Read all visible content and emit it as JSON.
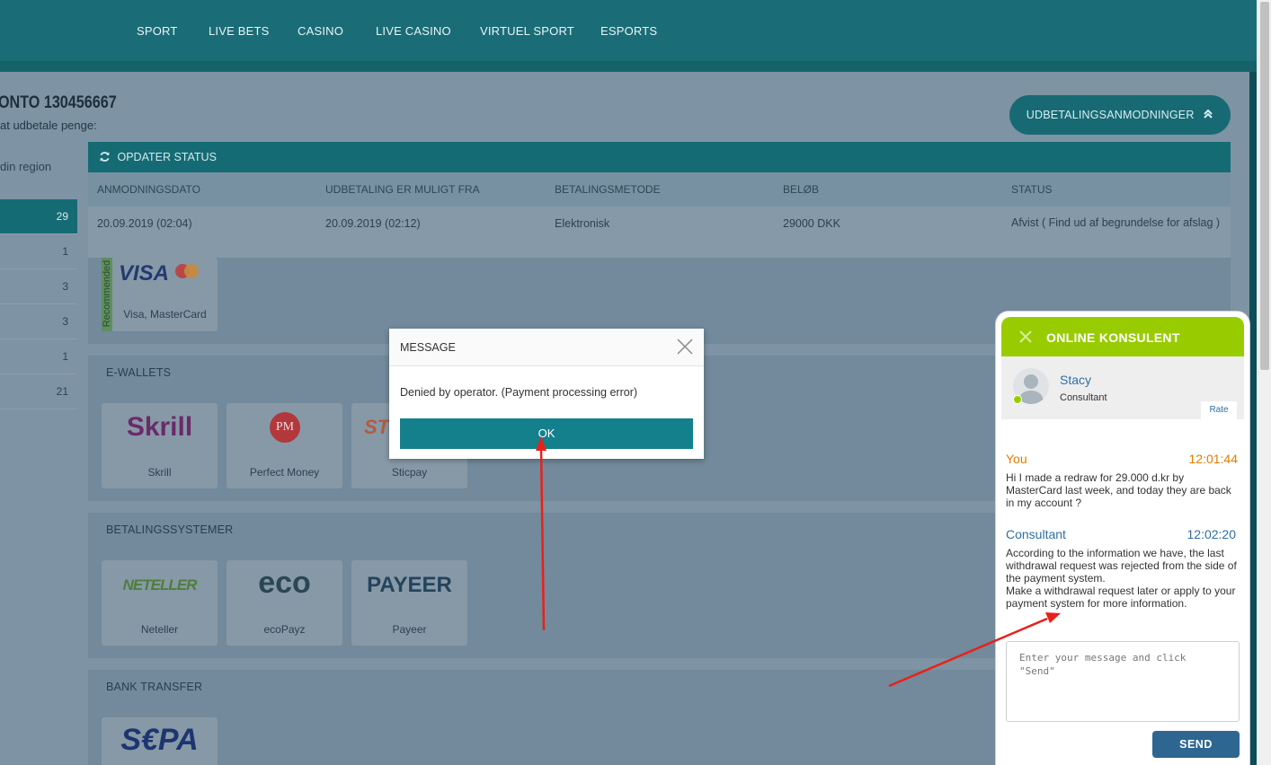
{
  "nav": {
    "items": [
      "SPORT",
      "LIVE BETS",
      "CASINO",
      "LIVE CASINO",
      "VIRTUEL SPORT",
      "ESPORTS"
    ]
  },
  "account": {
    "title": "ONTO 130456667",
    "subtitle": "at udbetale penge:",
    "region": "din region"
  },
  "left_counts": [
    "29",
    "1",
    "3",
    "3",
    "1",
    "21"
  ],
  "withdraw_button": "UDBETALINGSANMODNINGER",
  "status": {
    "refresh_label": "OPDATER STATUS",
    "columns": [
      "ANMODNINGSDATO",
      "UDBETALING ER MULIGT FRA",
      "BETALINGSMETODE",
      "BELØB",
      "STATUS"
    ],
    "row": [
      "20.09.2019 (02:04)",
      "20.09.2019 (02:12)",
      "Elektronisk",
      "29000 DKK",
      "Afvist ( Find ud af begrundelse for afslag )"
    ]
  },
  "cards_section": {
    "recommended_badge": "Recommended",
    "visa_logo": "VISA",
    "visa_label": "Visa, MasterCard"
  },
  "ewallets": {
    "title": "E-WALLETS",
    "cards": [
      {
        "logo": "Skrill",
        "label": "Skrill"
      },
      {
        "logo": "PM",
        "label": "Perfect Money"
      },
      {
        "logo": "ST",
        "label": "Sticpay"
      }
    ]
  },
  "payment_systems": {
    "title": "BETALINGSSYSTEMER",
    "cards": [
      {
        "logo": "NETELLER",
        "label": "Neteller"
      },
      {
        "logo": "eco",
        "label": "ecoPayz"
      },
      {
        "logo": "PAYEER",
        "label": "Payeer"
      }
    ]
  },
  "bank_transfer": {
    "title": "BANK TRANSFER",
    "logo": "S€PA"
  },
  "dialog": {
    "title": "MESSAGE",
    "message": "Denied by operator. (Payment processing error)",
    "ok_label": "OK"
  },
  "chat": {
    "title": "ONLINE KONSULENT",
    "agent_name": "Stacy",
    "agent_role": "Consultant",
    "rate_label": "Rate",
    "messages": [
      {
        "sender": "You",
        "time": "12:01:44",
        "text": "Hi I made a redraw for 29.000 d.kr by MasterCard last week, and today they are back in my account ?"
      },
      {
        "sender": "Consultant",
        "time": "12:02:20",
        "text": "According to the information we have, the last withdrawal request was rejected from the side of the payment system.\nMake a withdrawal request later or apply to your payment system for more information."
      }
    ],
    "input_placeholder": "Enter your message and click \"Send\"",
    "send_label": "SEND"
  },
  "colors": {
    "nav_bg": "#1a6d77",
    "dialog_ok": "#13808c",
    "chat_header": "#99cc00",
    "send_button": "#2d6791",
    "annotation_arrow": "#e8211a"
  }
}
